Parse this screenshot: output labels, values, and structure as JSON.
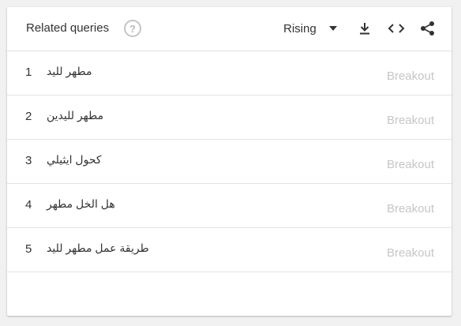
{
  "widget": {
    "title": "Related queries",
    "help_symbol": "?",
    "filter_value": "Rising",
    "icons": [
      "help-icon",
      "download-icon",
      "embed-icon",
      "share-icon"
    ]
  },
  "queries": [
    {
      "rank": "1",
      "term": "مطهر لليد",
      "value": "Breakout"
    },
    {
      "rank": "2",
      "term": "مطهر لليدين",
      "value": "Breakout"
    },
    {
      "rank": "3",
      "term": "كحول ايثيلي",
      "value": "Breakout"
    },
    {
      "rank": "4",
      "term": "هل الخل مطهر",
      "value": "Breakout"
    },
    {
      "rank": "5",
      "term": "طريقة عمل مطهر لليد",
      "value": "Breakout"
    }
  ],
  "colors": {
    "text": "#333333",
    "muted": "#c6c6c6",
    "divider": "#e3e3e3",
    "background": "#f1f1f1"
  }
}
